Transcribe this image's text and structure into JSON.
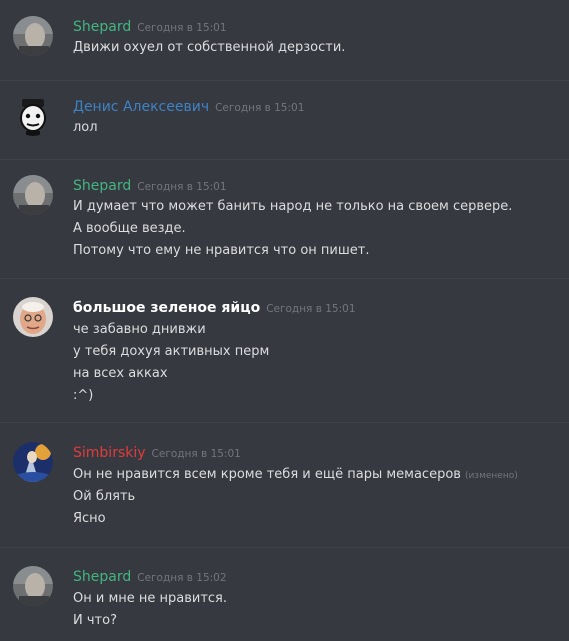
{
  "colors": {
    "background": "#36393f",
    "divider": "#3f4247",
    "message_text": "#dcddde",
    "timestamp": "#72767d",
    "shepard": "#43b581",
    "denis": "#3e82c6",
    "egg": "#ffffff",
    "simbirskiy": "#e03c3c"
  },
  "messages": [
    {
      "author": "Shepard",
      "timestamp": "Сегодня в 15:01",
      "lines": [
        "Движи охуел от собственной дерзости."
      ]
    },
    {
      "author": "Денис Алексеевич",
      "timestamp": "Сегодня в 15:01",
      "lines": [
        "лол"
      ]
    },
    {
      "author": "Shepard",
      "timestamp": "Сегодня в 15:01",
      "lines": [
        "И думает что может банить народ не только на своем сервере.",
        "А вообще везде.",
        "Потому что ему не нравится что он пишет."
      ]
    },
    {
      "author": "большое зеленое яйцо",
      "timestamp": "Сегодня в 15:01",
      "lines": [
        "че забавно днивжи",
        "у тебя дохуя активных перм",
        "на всех акках",
        ":^)"
      ]
    },
    {
      "author": "Simbirskiy",
      "timestamp": "Сегодня в 15:01",
      "lines": [
        "Он не нравится всем кроме тебя и ещё пары мемасеров",
        "Ой блять",
        "Ясно"
      ],
      "edited_label": "(изменено)"
    },
    {
      "author": "Shepard",
      "timestamp": "Сегодня в 15:02",
      "lines": [
        "Он и мне не нравится.",
        "И что?"
      ]
    }
  ]
}
